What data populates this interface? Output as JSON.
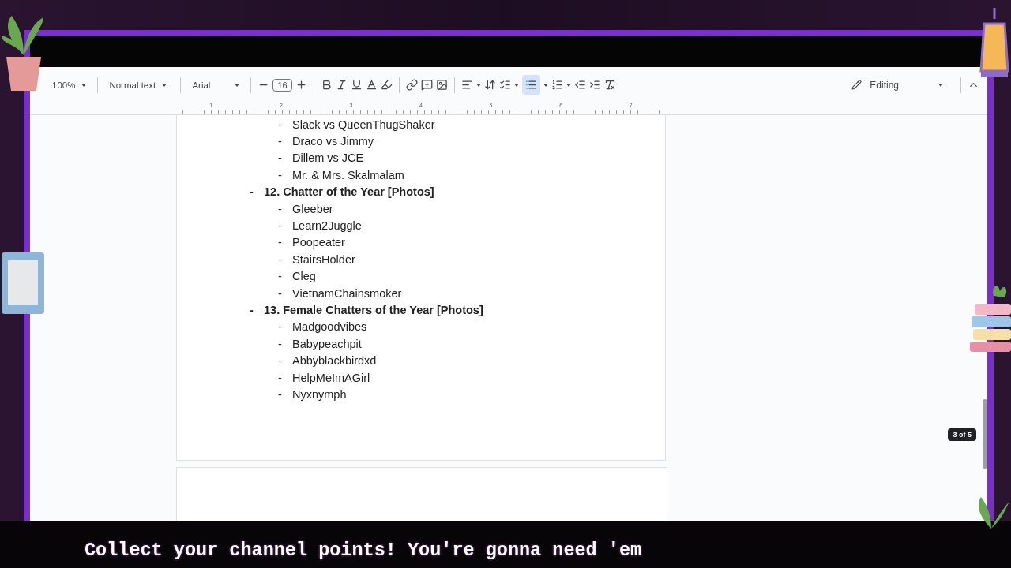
{
  "toolbar": {
    "zoom": "100%",
    "style": "Normal text",
    "font": "Arial",
    "font_size": "16",
    "bullet_list": {
      "selected": true
    },
    "mode": "Editing"
  },
  "ruler": {
    "marks": [
      "1",
      "2",
      "3",
      "4",
      "5",
      "6",
      "7"
    ]
  },
  "document": {
    "continued_items": [
      {
        "bullet": "-",
        "text": "Slack vs QueenThugShaker"
      },
      {
        "bullet": "-",
        "text": "Draco vs Jimmy"
      },
      {
        "bullet": "-",
        "text": "Dillem vs JCE"
      },
      {
        "bullet": "-",
        "text": "Mr. & Mrs. Skalmalam"
      }
    ],
    "sections": [
      {
        "bullet": "-",
        "title": "12. Chatter of the Year [Photos]",
        "children": [
          {
            "bullet": "-",
            "text": "Gleeber"
          },
          {
            "bullet": "-",
            "text": "Learn2Juggle"
          },
          {
            "bullet": "-",
            "text": "Poopeater"
          },
          {
            "bullet": "-",
            "text": "StairsHolder"
          },
          {
            "bullet": "-",
            "text": "Cleg"
          },
          {
            "bullet": "-",
            "text": "VietnamChainsmoker"
          }
        ]
      },
      {
        "bullet": "-",
        "title": "13. Female Chatters of the Year [Photos]",
        "children": [
          {
            "bullet": "-",
            "text": "Madgoodvibes"
          },
          {
            "bullet": "-",
            "text": "Babypeachpit"
          },
          {
            "bullet": "-",
            "text": "Abbyblackbirdxd"
          },
          {
            "bullet": "-",
            "text": "HelpMeImAGirl"
          },
          {
            "bullet": "-",
            "text": "Nyxnymph"
          }
        ]
      }
    ]
  },
  "page_counter": "3 of 5",
  "caption": "Collect your channel points! You're gonna need 'em"
}
